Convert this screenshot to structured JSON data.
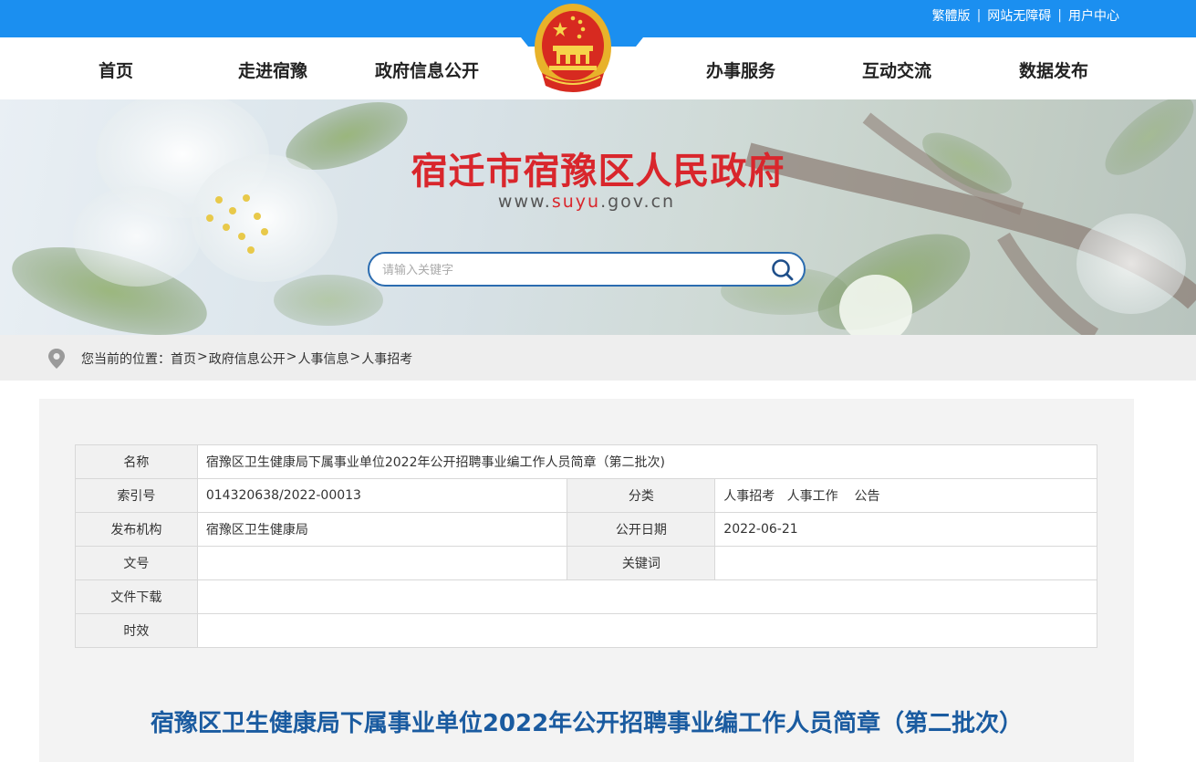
{
  "top_links": [
    "繁體版",
    "网站无障碍",
    "用户中心"
  ],
  "nav": {
    "left": [
      "首页",
      "走进宿豫",
      "政府信息公开"
    ],
    "right": [
      "办事服务",
      "互动交流",
      "数据发布"
    ]
  },
  "banner": {
    "site_name": "宿迁市宿豫区人民政府",
    "url_prefix": "www.",
    "url_domain": "suyu",
    "url_suffix": ".gov.cn",
    "search_placeholder": "请输入关键字"
  },
  "breadcrumb": {
    "label": "您当前的位置：",
    "items": [
      "首页",
      "政府信息公开",
      "人事信息",
      "人事招考"
    ],
    "separators": [
      ">",
      ">",
      ">"
    ]
  },
  "meta_table": {
    "name_label": "名称",
    "name_value": "宿豫区卫生健康局下属事业单位2022年公开招聘事业编工作人员简章（第二批次)",
    "index_label": "索引号",
    "index_value": "014320638/2022-00013",
    "category_label": "分类",
    "category_value": "人事招考   人事工作    公告",
    "publisher_label": "发布机构",
    "publisher_value": "宿豫区卫生健康局",
    "date_label": "公开日期",
    "date_value": "2022-06-21",
    "docno_label": "文号",
    "docno_value": "",
    "keywords_label": "关键词",
    "keywords_value": "",
    "download_label": "文件下载",
    "download_value": "",
    "validity_label": "时效",
    "validity_value": ""
  },
  "document_title": "宿豫区卫生健康局下属事业单位2022年公开招聘事业编工作人员简章（第二批次）",
  "colors": {
    "top_bar": "#1b8ff0",
    "title_red": "#d9262c",
    "doc_title_blue": "#1a5ba0"
  }
}
